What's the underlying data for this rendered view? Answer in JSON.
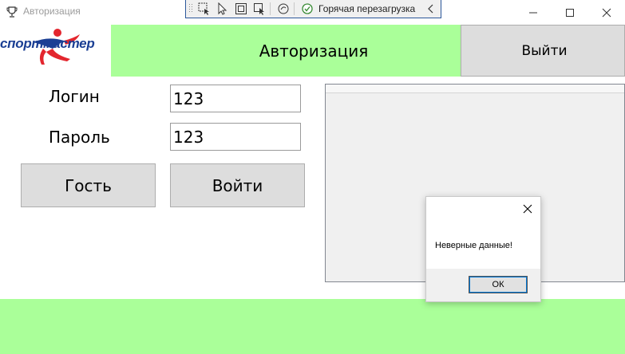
{
  "window": {
    "title": "Авторизация",
    "icon": "trophy-icon"
  },
  "debug_toolbar": {
    "tools": [
      "select-element-icon",
      "pointer-icon",
      "display-layout-icon",
      "track-focus-icon",
      "binding-failures-icon"
    ],
    "hot_reload_label": "Горячая перезагрузка",
    "hot_reload_status": "check-circle-icon"
  },
  "header": {
    "logo_text": "спортмастер",
    "title": "Авторизация",
    "exit_label": "Выйти"
  },
  "form": {
    "login_label": "Логин",
    "login_value": "123",
    "password_label": "Пароль",
    "password_value": "123",
    "guest_label": "Гость",
    "enter_label": "Войти"
  },
  "dialog": {
    "message": "Неверные данные!",
    "ok_label": "ОК"
  },
  "colors": {
    "accent_green": "#aaff99",
    "button_gray": "#dddddd",
    "logo_blue": "#1b3f94",
    "logo_red": "#e3262e"
  }
}
